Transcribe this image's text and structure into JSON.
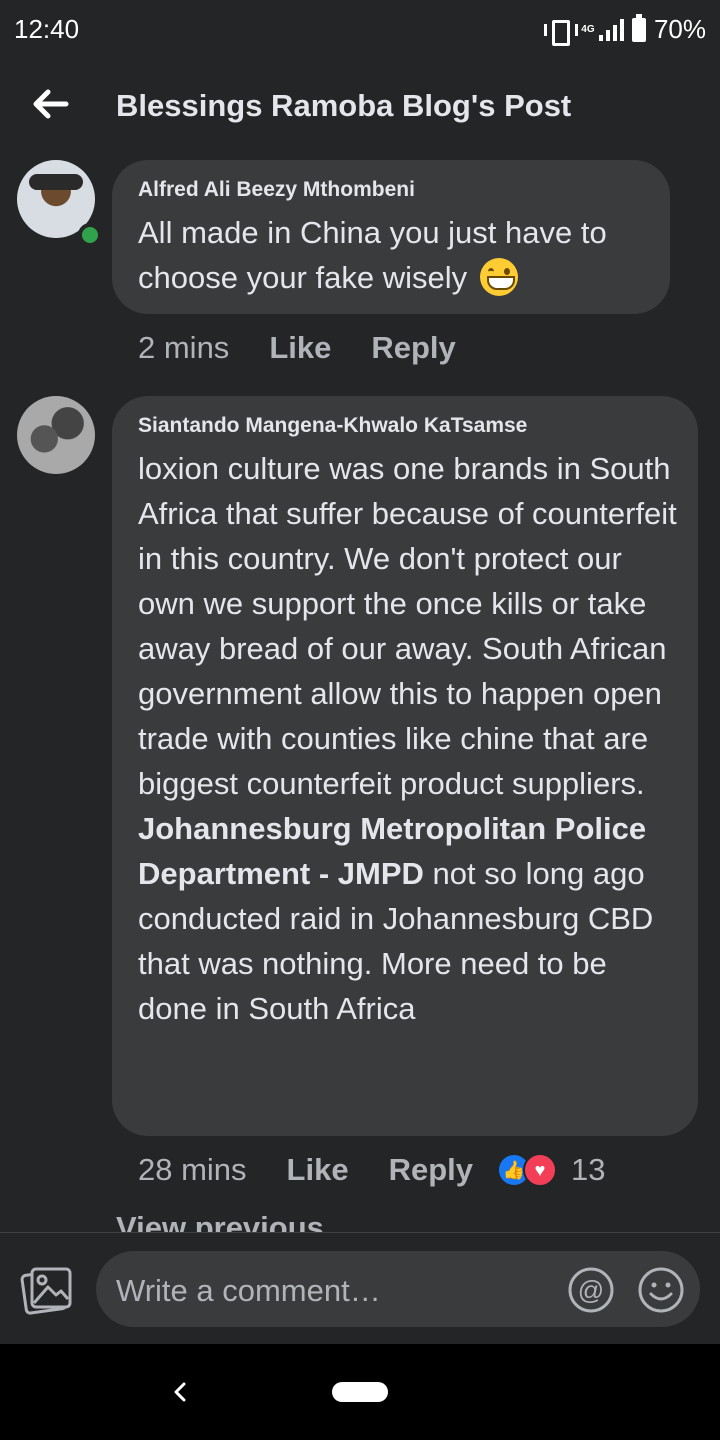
{
  "status_bar": {
    "time": "12:40",
    "network": "4G",
    "battery": "70%"
  },
  "header": {
    "title": "Blessings Ramoba Blog's Post"
  },
  "comments": [
    {
      "author": "Alfred Ali Beezy Mthombeni",
      "text": "All made in China you just have to choose your fake wisely",
      "time": "2 mins",
      "like_label": "Like",
      "reply_label": "Reply",
      "online": true
    },
    {
      "author": "Siantando Mangena-Khwalo KaTsamse",
      "text_before": "loxion culture was one brands in South Africa that suffer because of counterfeit in this country. We don't protect our own we support the once kills or take away bread of our away. South African government allow this to happen open trade with counties like chine that are biggest counterfeit product suppliers. ",
      "mention": "Johannesburg Metropolitan Police Department - JMPD",
      "text_after": "  not so long ago conducted raid in Johannesburg CBD that was nothing. More need to be done in South Africa",
      "time": "28 mins",
      "like_label": "Like",
      "reply_label": "Reply",
      "reaction_count": "13"
    }
  ],
  "more_replies": "View previous replies",
  "composer": {
    "placeholder": "Write a comment…"
  },
  "colors": {
    "background": "#242526",
    "bubble": "#3a3b3c",
    "online": "#31a24c",
    "like": "#1877f2",
    "love": "#f33e58"
  }
}
